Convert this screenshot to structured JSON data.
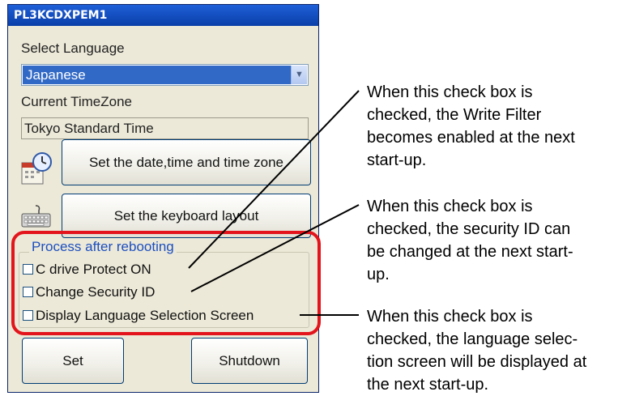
{
  "window": {
    "title": "PL3KCDXPEM1",
    "select_language_label": "Select Language",
    "language_value": "Japanese",
    "current_timezone_label": "Current TimeZone",
    "timezone_value": "Tokyo Standard Time",
    "datetime_button": "Set the date,time and time zone",
    "keyboard_button": "Set the keyboard layout",
    "group_title": "Process after rebooting",
    "checkboxes": [
      {
        "label": "C drive Protect ON",
        "checked": false
      },
      {
        "label": "Change Security ID",
        "checked": false
      },
      {
        "label": "Display Language Selection Screen",
        "checked": false
      }
    ],
    "set_button": "Set",
    "shutdown_button": "Shutdown"
  },
  "callouts": [
    {
      "lines": [
        "When this check box is",
        "checked, the Write Filter",
        "becomes enabled at the next",
        "start-up."
      ]
    },
    {
      "lines": [
        "When this check box is",
        "checked, the security ID can",
        "be changed at the next start-",
        "up."
      ]
    },
    {
      "lines": [
        "When this check box is",
        "checked, the language selec-",
        "tion screen will be displayed at",
        "the next start-up."
      ]
    }
  ],
  "colors": {
    "highlight": "#e3141b",
    "titlebar": "#0a3fa8",
    "selection": "#3169c6"
  }
}
